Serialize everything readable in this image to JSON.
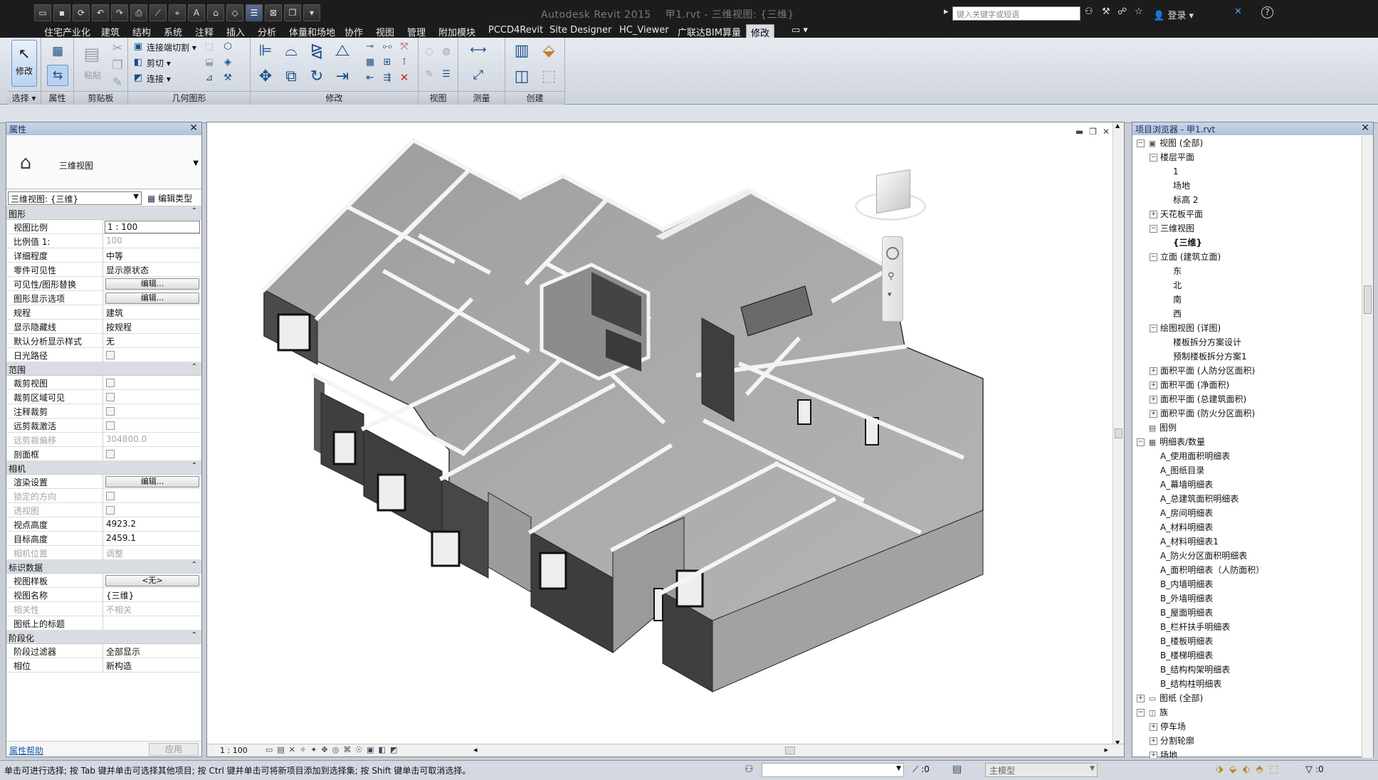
{
  "app": {
    "title": "Autodesk Revit 2015",
    "file_title": "甲1.rvt - 三维视图: {三维}",
    "search_placeholder": "键入关键字或短语",
    "login": "登录",
    "help": "?"
  },
  "tabs": [
    "住宅产业化",
    "建筑",
    "结构",
    "系统",
    "注释",
    "插入",
    "分析",
    "体量和场地",
    "协作",
    "视图",
    "管理",
    "附加模块",
    "PCCD4Revit",
    "Site Designer",
    "HC_Viewer",
    "广联达BIM算量",
    "修改"
  ],
  "ribbon": {
    "select": {
      "label": "修改",
      "panel": "选择 ▾"
    },
    "properties": {
      "panel": "属性"
    },
    "clipboard": {
      "paste": "粘贴",
      "panel": "剪贴板"
    },
    "geometry": {
      "join_cut": "连接端切割",
      "cut": "剪切",
      "join": "连接",
      "panel": "几何图形"
    },
    "modify": {
      "panel": "修改"
    },
    "view": {
      "panel": "视图"
    },
    "measure": {
      "panel": "测量"
    },
    "create": {
      "panel": "创建"
    }
  },
  "properties": {
    "title": "属性",
    "type_name": "三维视图",
    "instance_selector": "三维视图: {三维}",
    "edit_type": "编辑类型",
    "groups": [
      {
        "name": "图形",
        "rows": [
          {
            "name": "视图比例",
            "value": "1 : 100",
            "kind": "input"
          },
          {
            "name": "比例值 1:",
            "value": "100",
            "kind": "ro"
          },
          {
            "name": "详细程度",
            "value": "中等",
            "kind": "text"
          },
          {
            "name": "零件可见性",
            "value": "显示原状态",
            "kind": "text"
          },
          {
            "name": "可见性/图形替换",
            "value": "编辑...",
            "kind": "button"
          },
          {
            "name": "图形显示选项",
            "value": "编辑...",
            "kind": "button"
          },
          {
            "name": "规程",
            "value": "建筑",
            "kind": "text"
          },
          {
            "name": "显示隐藏线",
            "value": "按规程",
            "kind": "text"
          },
          {
            "name": "默认分析显示样式",
            "value": "无",
            "kind": "text"
          },
          {
            "name": "日光路径",
            "value": "",
            "kind": "check"
          }
        ]
      },
      {
        "name": "范围",
        "rows": [
          {
            "name": "裁剪视图",
            "value": "",
            "kind": "check"
          },
          {
            "name": "裁剪区域可见",
            "value": "",
            "kind": "check"
          },
          {
            "name": "注释裁剪",
            "value": "",
            "kind": "check"
          },
          {
            "name": "远剪裁激活",
            "value": "",
            "kind": "check"
          },
          {
            "name": "远剪裁偏移",
            "value": "304800.0",
            "kind": "ro",
            "ro": true
          },
          {
            "name": "剖面框",
            "value": "",
            "kind": "check"
          }
        ]
      },
      {
        "name": "相机",
        "rows": [
          {
            "name": "渲染设置",
            "value": "编辑...",
            "kind": "button"
          },
          {
            "name": "锁定的方向",
            "value": "",
            "kind": "check",
            "ro": true
          },
          {
            "name": "透视图",
            "value": "",
            "kind": "check",
            "ro": true
          },
          {
            "name": "视点高度",
            "value": "4923.2",
            "kind": "text"
          },
          {
            "name": "目标高度",
            "value": "2459.1",
            "kind": "text"
          },
          {
            "name": "相机位置",
            "value": "调整",
            "kind": "ro",
            "ro": true
          }
        ]
      },
      {
        "name": "标识数据",
        "rows": [
          {
            "name": "视图样板",
            "value": "<无>",
            "kind": "button"
          },
          {
            "name": "视图名称",
            "value": "{三维}",
            "kind": "text"
          },
          {
            "name": "相关性",
            "value": "不相关",
            "kind": "ro",
            "ro": true
          },
          {
            "name": "图纸上的标题",
            "value": "",
            "kind": "text"
          }
        ]
      },
      {
        "name": "阶段化",
        "rows": [
          {
            "name": "阶段过滤器",
            "value": "全部显示",
            "kind": "text"
          },
          {
            "name": "相位",
            "value": "新构造",
            "kind": "text"
          }
        ]
      }
    ],
    "help_link": "属性帮助",
    "apply": "应用"
  },
  "view": {
    "scale": "1 : 100"
  },
  "browser": {
    "title": "项目浏览器 - 甲1.rvt",
    "nodes": [
      {
        "level": 0,
        "toggle": "−",
        "icon": "view",
        "label": "视图 (全部)"
      },
      {
        "level": 1,
        "toggle": "−",
        "label": "楼层平面"
      },
      {
        "level": 2,
        "label": "1"
      },
      {
        "level": 2,
        "label": "场地"
      },
      {
        "level": 2,
        "label": "标高 2"
      },
      {
        "level": 1,
        "toggle": "+",
        "label": "天花板平面"
      },
      {
        "level": 1,
        "toggle": "−",
        "label": "三维视图"
      },
      {
        "level": 2,
        "label": "{三维}",
        "bold": true
      },
      {
        "level": 1,
        "toggle": "−",
        "label": "立面 (建筑立面)"
      },
      {
        "level": 2,
        "label": "东"
      },
      {
        "level": 2,
        "label": "北"
      },
      {
        "level": 2,
        "label": "南"
      },
      {
        "level": 2,
        "label": "西"
      },
      {
        "level": 1,
        "toggle": "−",
        "label": "绘图视图 (详图)"
      },
      {
        "level": 2,
        "label": "楼板拆分方案设计"
      },
      {
        "level": 2,
        "label": "预制楼板拆分方案1"
      },
      {
        "level": 1,
        "toggle": "+",
        "label": "面积平面 (人防分区面积)"
      },
      {
        "level": 1,
        "toggle": "+",
        "label": "面积平面 (净面积)"
      },
      {
        "level": 1,
        "toggle": "+",
        "label": "面积平面 (总建筑面积)"
      },
      {
        "level": 1,
        "toggle": "+",
        "label": "面积平面 (防火分区面积)"
      },
      {
        "level": 0,
        "icon": "legend",
        "label": "图例"
      },
      {
        "level": 0,
        "toggle": "−",
        "icon": "table",
        "label": "明细表/数量"
      },
      {
        "level": 1,
        "label": "A_使用面积明细表"
      },
      {
        "level": 1,
        "label": "A_图纸目录"
      },
      {
        "level": 1,
        "label": "A_幕墙明细表"
      },
      {
        "level": 1,
        "label": "A_总建筑面积明细表"
      },
      {
        "level": 1,
        "label": "A_房间明细表"
      },
      {
        "level": 1,
        "label": "A_材料明细表"
      },
      {
        "level": 1,
        "label": "A_材料明细表1"
      },
      {
        "level": 1,
        "label": "A_防火分区面积明细表"
      },
      {
        "level": 1,
        "label": "A_面积明细表（人防面积）"
      },
      {
        "level": 1,
        "label": "B_内墙明细表"
      },
      {
        "level": 1,
        "label": "B_外墙明细表"
      },
      {
        "level": 1,
        "label": "B_屋面明细表"
      },
      {
        "level": 1,
        "label": "B_栏杆扶手明细表"
      },
      {
        "level": 1,
        "label": "B_楼板明细表"
      },
      {
        "level": 1,
        "label": "B_楼梯明细表"
      },
      {
        "level": 1,
        "label": "B_结构构架明细表"
      },
      {
        "level": 1,
        "label": "B_结构柱明细表"
      },
      {
        "level": 0,
        "toggle": "+",
        "icon": "sheet",
        "label": "图纸 (全部)"
      },
      {
        "level": 0,
        "toggle": "−",
        "icon": "family",
        "label": "族"
      },
      {
        "level": 1,
        "toggle": "+",
        "label": "停车场"
      },
      {
        "level": 1,
        "toggle": "+",
        "label": "分割轮廓"
      },
      {
        "level": 1,
        "toggle": "+",
        "label": "场地"
      }
    ]
  },
  "status": {
    "message": "单击可进行选择; 按 Tab 键并单击可选择其他项目; 按 Ctrl 键并单击可将新项目添加到选择集; 按 Shift 键单击可取消选择。",
    "count": ":0",
    "model": "主模型",
    "filter_count": ":0"
  },
  "colors": {
    "tab_selected": "#d8dde6",
    "title_bg": "#1c1c1c",
    "panel_header": "#c8d6e9",
    "link": "#1a5ba8"
  }
}
